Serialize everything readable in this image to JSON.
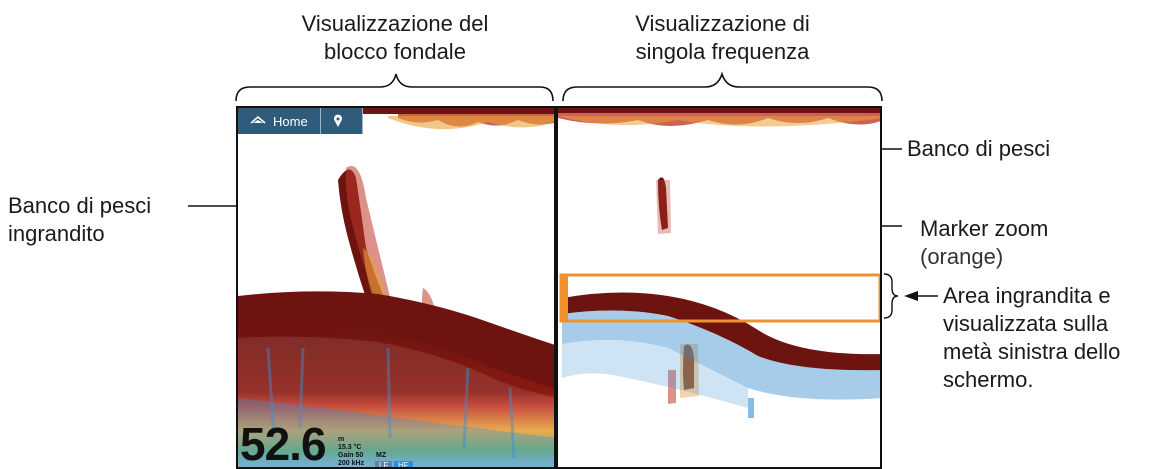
{
  "headings": {
    "left": [
      "Visualizzazione del",
      "blocco fondale"
    ],
    "right": [
      "Visualizzazione di",
      "singola frequenza"
    ]
  },
  "callouts": {
    "enlarged_school": [
      "Banco di pesci",
      "ingrandito"
    ],
    "school": "Banco di pesci",
    "zoom_marker": [
      "Marker zoom",
      "(orange)"
    ],
    "zoom_area": [
      "Area ingrandita e",
      "visualizzata sulla",
      "metà sinistra dello",
      "schermo."
    ]
  },
  "toolbar": {
    "home_label": "Home",
    "icons": [
      "home-icon",
      "location-pin-icon"
    ]
  },
  "readout": {
    "depth": "52.6",
    "unit": "m",
    "temperature": "15.3 °C",
    "gain": "Gain 50",
    "frequency": "200 kHz",
    "mode": "MZ",
    "lf": "LF",
    "hf": "HF"
  },
  "colors": {
    "toolbar": "#2f5b7c",
    "zoom_marker": "#f0922b",
    "seabed": "#6e1410",
    "echo_strong": "#c0392b",
    "echo_mid": "#e8a23a",
    "echo_weak": "#3a8fd0"
  }
}
